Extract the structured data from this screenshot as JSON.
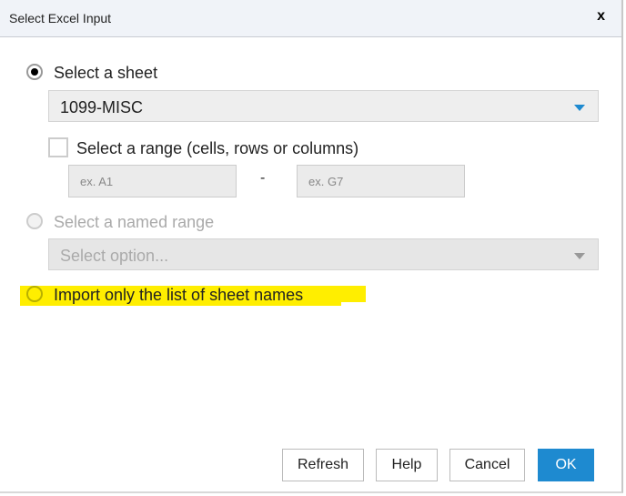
{
  "dialog": {
    "title": "Select Excel Input",
    "close": "x"
  },
  "sheet": {
    "label": "Select a sheet",
    "selected": true,
    "value": "1099-MISC"
  },
  "range": {
    "label": "Select a range (cells, rows or columns)",
    "checked": false,
    "from_placeholder": "ex. A1",
    "to_placeholder": "ex. G7",
    "separator": "-"
  },
  "named_range": {
    "label": "Select a named range",
    "enabled": false,
    "placeholder": "Select option..."
  },
  "sheet_names": {
    "label": "Import only the list of sheet names",
    "selected": false
  },
  "buttons": {
    "refresh": "Refresh",
    "help": "Help",
    "cancel": "Cancel",
    "ok": "OK"
  },
  "colors": {
    "accent": "#1e8ad0",
    "highlight": "#ffee00"
  }
}
